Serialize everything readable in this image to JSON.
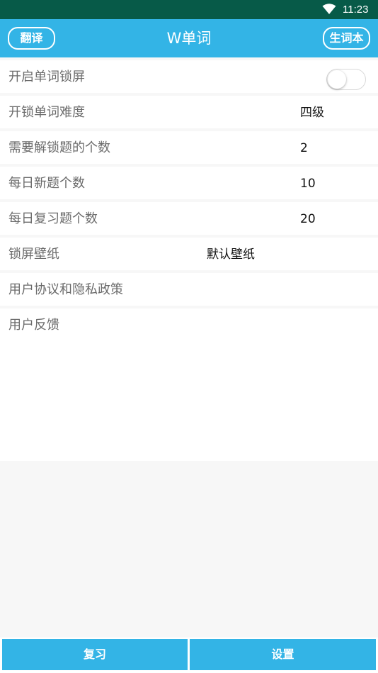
{
  "status_bar": {
    "time": "11:23",
    "wifi_icon": "wifi-icon"
  },
  "header": {
    "title": "W单词",
    "left_button": "翻译",
    "right_button": "生词本",
    "bg_color": "#33b4e6"
  },
  "settings": [
    {
      "label": "开启单词锁屏",
      "type": "toggle",
      "on": false
    },
    {
      "label": "开锁单词难度",
      "value": "四级"
    },
    {
      "label": "需要解锁题的个数",
      "value": "2"
    },
    {
      "label": "每日新题个数",
      "value": "10"
    },
    {
      "label": "每日复习题个数",
      "value": "20"
    },
    {
      "label": "锁屏壁纸",
      "value": "默认壁纸"
    },
    {
      "label": "用户协议和隐私政策"
    },
    {
      "label": "用户反馈"
    }
  ],
  "bottom_tabs": [
    {
      "label": "复习"
    },
    {
      "label": "设置"
    }
  ]
}
